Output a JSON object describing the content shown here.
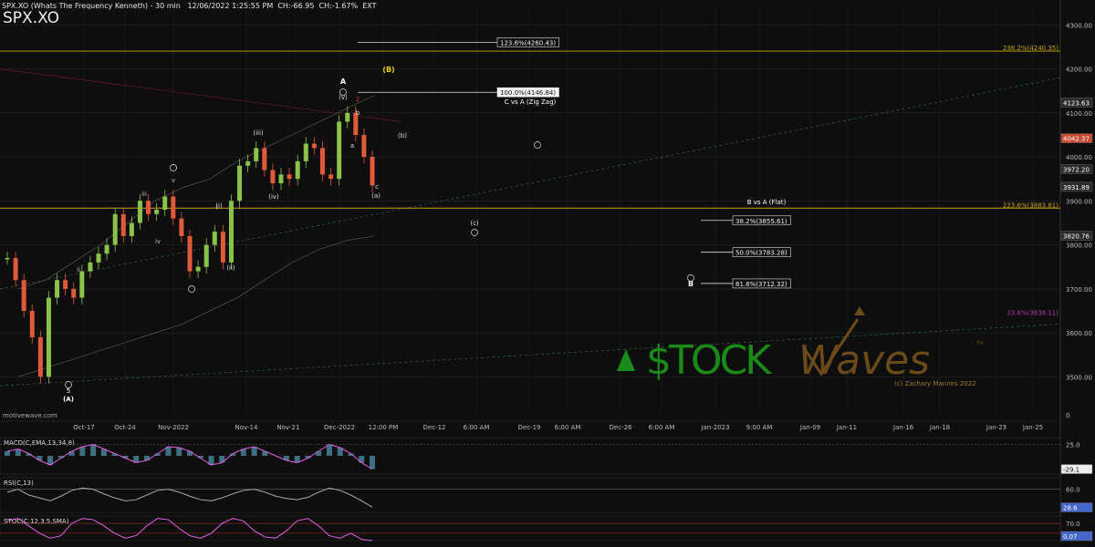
{
  "header": {
    "title": "SPX.XO (Whats The Frequency Kenneth) - 30 min",
    "datetime": "12/06/2022 1:25:55 PM",
    "change": "CH:-66.95",
    "change_pct": "CH:-1.67%",
    "session": "EXT",
    "symbol": "SPX.XO",
    "watermark_site": "motivewave.com"
  },
  "logo": {
    "brand": "$TOCKWaves",
    "copyright": "(c) Zachary Mannes 2022"
  },
  "colors": {
    "background": "#0e0e0e",
    "up_candle": "#8bc34a",
    "down_candle": "#e05a3a",
    "fib_line": "#c9a400",
    "grid": "#2a2a2a",
    "macd_line": "#e060e0",
    "macd_hist": "#5fb0d0",
    "logo_green": "#1a8a1a",
    "logo_brown": "#6b4a1a"
  },
  "chart_data": [
    {
      "type": "line",
      "title": "SPX.XO",
      "x_ticks": [
        "Oct-17",
        "Oct-24",
        "Nov-2022",
        "Nov-14",
        "Nov-21",
        "Dec-2022",
        "12:00 PM",
        "Dec-12",
        "6:00 AM",
        "Dec-19",
        "6:00 AM",
        "Dec-26",
        "6:00 AM",
        "Jan-2023",
        "9:00 AM",
        "Jan-09",
        "Jan-11",
        "Jan-16",
        "Jan-18",
        "Jan-23",
        "Jan-25"
      ],
      "y_ticks": [
        3500,
        3600,
        3700,
        3800,
        3900,
        4000,
        4100,
        4200,
        4300
      ],
      "ylim": [
        3420,
        4340
      ],
      "price_tags": [
        {
          "value": 4123.63,
          "text": "4123.63",
          "color": "#cccccc"
        },
        {
          "value": 4042.37,
          "text": "4042.37",
          "color": "#e05a3a"
        },
        {
          "value": 3972.2,
          "text": "3972.20",
          "color": "#cccccc"
        },
        {
          "value": 3931.89,
          "text": "3931.89",
          "color": "#cccccc"
        },
        {
          "value": 3820.76,
          "text": "3820.76",
          "color": "#cccccc"
        }
      ],
      "series": [
        {
          "name": "",
          "points": [
            [
              "Oct-13",
              3770
            ],
            [
              "Oct-14",
              3720
            ],
            [
              "Oct-15",
              3650
            ],
            [
              "Oct-16",
              3590
            ],
            [
              "Oct-16b",
              3500
            ],
            [
              "Oct-17",
              3680
            ],
            [
              "Oct-18",
              3720
            ],
            [
              "Oct-19",
              3700
            ],
            [
              "Oct-20",
              3680
            ],
            [
              "Oct-21",
              3740
            ],
            [
              "Oct-22",
              3760
            ],
            [
              "Oct-23",
              3780
            ],
            [
              "Oct-24",
              3800
            ],
            [
              "Oct-25",
              3870
            ],
            [
              "Oct-26",
              3820
            ],
            [
              "Oct-27",
              3850
            ],
            [
              "Oct-28",
              3900
            ],
            [
              "Oct-29",
              3870
            ],
            [
              "Oct-30",
              3880
            ],
            [
              "Oct-31",
              3910
            ],
            [
              "Nov-01",
              3860
            ],
            [
              "Nov-02",
              3820
            ],
            [
              "Nov-03",
              3740
            ],
            [
              "Nov-04",
              3750
            ],
            [
              "Nov-07",
              3800
            ],
            [
              "Nov-08",
              3830
            ],
            [
              "Nov-09",
              3760
            ],
            [
              "Nov-10",
              3900
            ],
            [
              "Nov-11",
              3980
            ],
            [
              "Nov-14",
              3990
            ],
            [
              "Nov-15",
              4020
            ],
            [
              "Nov-16",
              3970
            ],
            [
              "Nov-17",
              3940
            ],
            [
              "Nov-18",
              3960
            ],
            [
              "Nov-21",
              3950
            ],
            [
              "Nov-22",
              3990
            ],
            [
              "Nov-23",
              4030
            ],
            [
              "Nov-25",
              4020
            ],
            [
              "Nov-28",
              3960
            ],
            [
              "Nov-29",
              3950
            ],
            [
              "Nov-30",
              4080
            ],
            [
              "Dec-01",
              4100
            ],
            [
              "Dec-02",
              4050
            ],
            [
              "Dec-05",
              4000
            ],
            [
              "Dec-06",
              3935
            ]
          ]
        }
      ],
      "fib_levels": [
        {
          "label": "123.6%(4260.43)",
          "value": 4260.43
        },
        {
          "label": "100.0%(4146.84)",
          "value": 4146.84
        },
        {
          "label": "38.2%(3855.61)",
          "value": 3855.61
        },
        {
          "label": "50.0%(3783.28)",
          "value": 3783.28
        },
        {
          "label": "61.8%(3712.32)",
          "value": 3712.32
        }
      ],
      "horizontal_levels": [
        {
          "label": "238.2%(4240.35)",
          "value": 4240.35
        },
        {
          "label": "223.6%(3883.61)",
          "value": 3883.61
        },
        {
          "label": "23.6%(3638.11)",
          "value": 3638.11
        }
      ],
      "annotations": [
        "(B)",
        "A",
        "C vs A (Zig Zag)",
        "B vs A (Flat)",
        "B",
        "(A)",
        "(a)",
        "(b)",
        "(c)",
        "c",
        "b",
        "a",
        "i",
        "ii",
        "iii",
        "iv",
        "v",
        "(i)",
        "(ii)",
        "(iii)",
        "(iv)",
        "(v)",
        "2",
        "5"
      ]
    },
    {
      "type": "line",
      "title": "MACD(C,EMA,13,34,8)",
      "y_ticks": [
        25.0
      ],
      "ylim": [
        -40,
        40
      ],
      "tag": "-29.1",
      "series": [
        {
          "name": "",
          "values": [
            10,
            15,
            5,
            -10,
            -20,
            -5,
            10,
            20,
            25,
            15,
            5,
            -5,
            -15,
            -10,
            5,
            20,
            18,
            10,
            -5,
            -20,
            -15,
            5,
            15,
            20,
            10,
            0,
            -10,
            -15,
            -5,
            10,
            25,
            18,
            5,
            -15,
            -29
          ]
        }
      ]
    },
    {
      "type": "line",
      "title": "RSI(C,13)",
      "y_ticks": [
        60.0
      ],
      "ylim": [
        20,
        80
      ],
      "tag": "28.6",
      "series": [
        {
          "name": "",
          "values": [
            55,
            60,
            50,
            45,
            40,
            48,
            58,
            62,
            60,
            52,
            45,
            40,
            42,
            50,
            58,
            60,
            55,
            48,
            42,
            40,
            45,
            52,
            58,
            60,
            55,
            48,
            44,
            42,
            46,
            55,
            62,
            58,
            50,
            40,
            29
          ]
        }
      ]
    },
    {
      "type": "line",
      "title": "STOC(C,12,3,5,SMA)",
      "y_ticks": [
        70.0,
        30.0
      ],
      "ylim": [
        0,
        100
      ],
      "tag": "0.07",
      "series": [
        {
          "name": "",
          "values": [
            80,
            90,
            60,
            30,
            10,
            20,
            70,
            90,
            85,
            60,
            30,
            10,
            20,
            60,
            90,
            85,
            50,
            20,
            10,
            30,
            70,
            90,
            80,
            40,
            15,
            10,
            40,
            80,
            90,
            60,
            20,
            10,
            30,
            5,
            0
          ]
        }
      ]
    }
  ]
}
